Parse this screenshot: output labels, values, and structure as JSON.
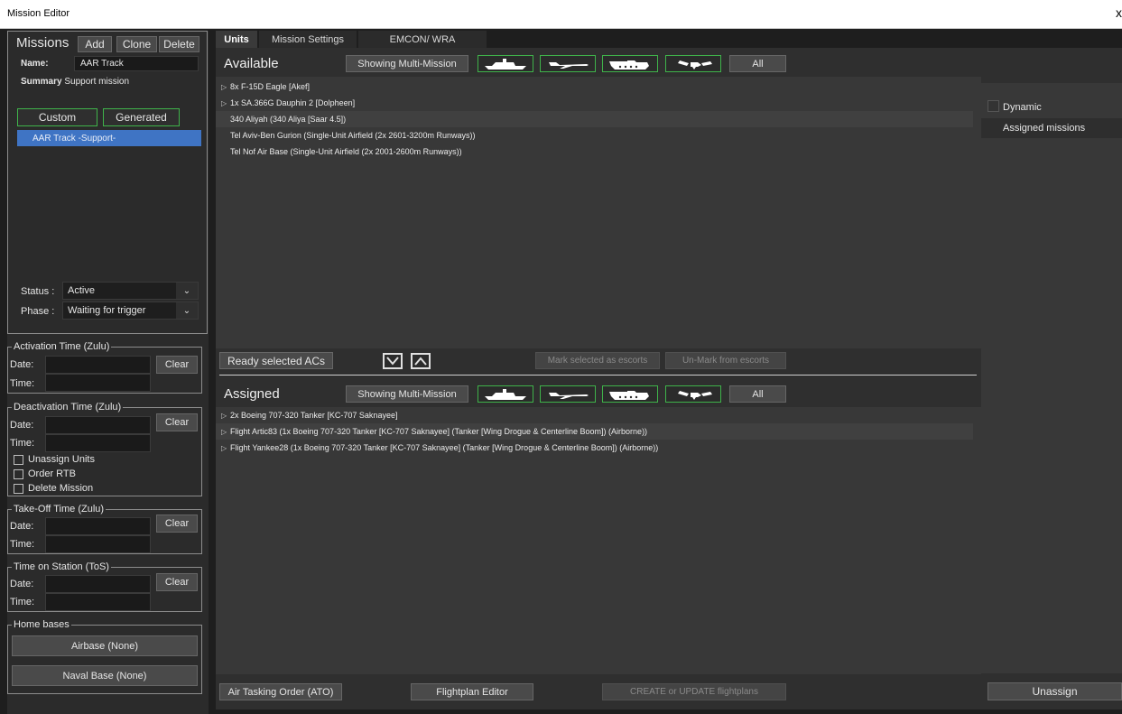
{
  "window": {
    "title": "Mission Editor",
    "close": "x"
  },
  "missions": {
    "heading": "Missions",
    "add": "Add",
    "clone": "Clone",
    "delete": "Delete",
    "name_label": "Name:",
    "name_value": "AAR Track",
    "summary_label": "Summary",
    "summary_value": "Support mission",
    "custom": "Custom",
    "generated": "Generated",
    "list": [
      "AAR Track  -Support-"
    ],
    "status_label": "Status :",
    "status_value": "Active",
    "phase_label": "Phase :",
    "phase_value": "Waiting for trigger"
  },
  "activation": {
    "legend": "Activation Time (Zulu)",
    "date_label": "Date:",
    "time_label": "Time:",
    "date": "",
    "time": "",
    "clear": "Clear"
  },
  "deactivation": {
    "legend": "Deactivation Time (Zulu)",
    "date_label": "Date:",
    "time_label": "Time:",
    "date": "",
    "time": "",
    "clear": "Clear",
    "options": [
      "Unassign Units",
      "Order RTB",
      "Delete Mission"
    ]
  },
  "takeoff": {
    "legend": "Take-Off Time (Zulu)",
    "date_label": "Date:",
    "time_label": "Time:",
    "date": "",
    "time": "",
    "clear": "Clear"
  },
  "tos": {
    "legend": "Time on Station (ToS)",
    "date_label": "Date:",
    "time_label": "Time:",
    "date": "",
    "time": "",
    "clear": "Clear"
  },
  "homebases": {
    "legend": "Home bases",
    "airbase": "Airbase (None)",
    "navalbase": "Naval Base (None)"
  },
  "tabs": [
    "Units",
    "Mission Settings",
    "EMCON/ WRA"
  ],
  "available": {
    "heading": "Available",
    "filter": "Showing Multi-Mission",
    "all": "All",
    "rows": [
      {
        "expand": true,
        "text": "8x F-15D Eagle [Akef]"
      },
      {
        "expand": true,
        "text": "1x SA.366G Dauphin 2 [Dolpheen]"
      },
      {
        "expand": false,
        "text": "340 Aliyah (340 Aliya [Saar 4.5])"
      },
      {
        "expand": false,
        "text": "Tel Aviv-Ben Gurion (Single-Unit Airfield (2x 2601-3200m Runways))"
      },
      {
        "expand": false,
        "text": "Tel Nof Air Base (Single-Unit Airfield (2x 2001-2600m Runways))"
      }
    ]
  },
  "midbar": {
    "ready": "Ready selected ACs",
    "mark": "Mark selected as escorts",
    "unmark": "Un-Mark from escorts"
  },
  "assigned": {
    "heading": "Assigned",
    "filter": "Showing Multi-Mission",
    "all": "All",
    "rows": [
      {
        "expand": true,
        "text": "2x Boeing 707-320 Tanker [KC-707 Saknayee]"
      },
      {
        "expand": true,
        "text": "Flight Artic83 (1x Boeing 707-320 Tanker [KC-707 Saknayee] (Tanker [Wing Drogue & Centerline Boom]) (Airborne))"
      },
      {
        "expand": true,
        "text": "Flight Yankee28 (1x Boeing 707-320 Tanker [KC-707 Saknayee] (Tanker [Wing Drogue & Centerline Boom]) (Airborne))"
      }
    ]
  },
  "bottom": {
    "ato": "Air Tasking Order (ATO)",
    "flightplan": "Flightplan Editor",
    "create": "CREATE or UPDATE flightplans",
    "unassign": "Unassign"
  },
  "side": {
    "dynamic": "Dynamic",
    "assigned_missions": "Assigned missions"
  },
  "colors": {
    "accent_green": "#3fb34a",
    "selection_blue": "#3f74c4"
  },
  "icons": {
    "filters": [
      "ship-icon",
      "aircraft-icon",
      "tank-icon",
      "satellite-icon"
    ]
  }
}
